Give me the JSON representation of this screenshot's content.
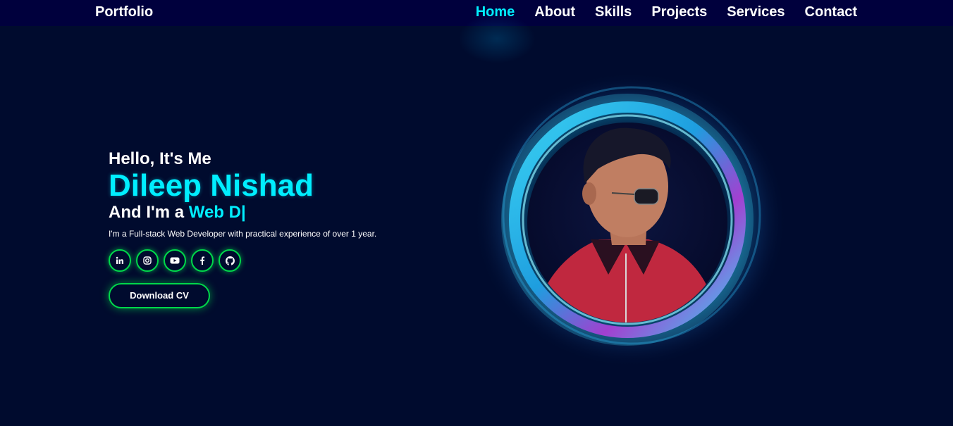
{
  "nav": {
    "logo": "Portfolio",
    "links": [
      {
        "label": "Home",
        "active": true
      },
      {
        "label": "About",
        "active": false
      },
      {
        "label": "Skills",
        "active": false
      },
      {
        "label": "Projects",
        "active": false
      },
      {
        "label": "Services",
        "active": false
      },
      {
        "label": "Contact",
        "active": false
      }
    ]
  },
  "hero": {
    "greeting": "Hello, It's Me",
    "name": "Dileep Nishad",
    "role_prefix": "And I'm a ",
    "role_typed": "Web D|",
    "bio": "I'm a Full-stack Web Developer with practical experience of over 1 year.",
    "socials": [
      {
        "icon": "linkedin-icon"
      },
      {
        "icon": "instagram-icon"
      },
      {
        "icon": "youtube-icon"
      },
      {
        "icon": "facebook-icon"
      },
      {
        "icon": "github-icon"
      }
    ],
    "cv_button": "Download CV"
  },
  "colors": {
    "background": "#000b2e",
    "navbar": "#00003d",
    "accent": "#00eeff",
    "glow_green": "#00d84a"
  }
}
